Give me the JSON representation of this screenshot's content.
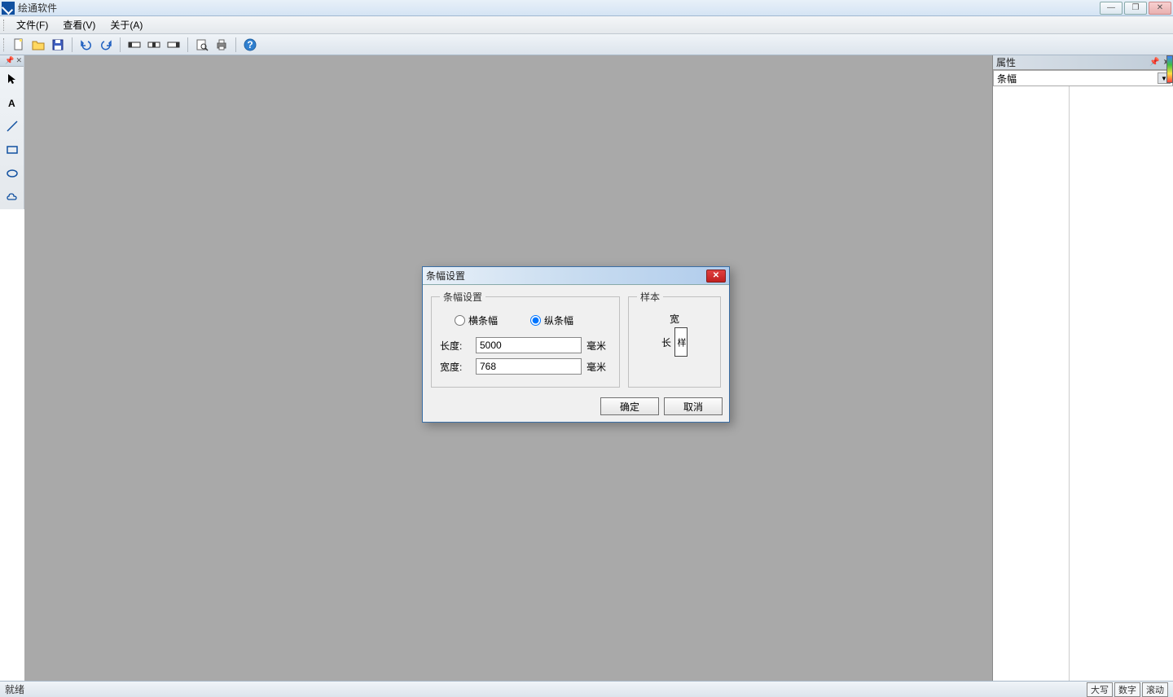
{
  "app": {
    "title": "绘通软件"
  },
  "menu": {
    "file": "文件(F)",
    "view": "查看(V)",
    "about": "关于(A)"
  },
  "toolbar_icons": {
    "new": "new-file-icon",
    "open": "open-folder-icon",
    "save": "save-icon",
    "undo": "undo-icon",
    "redo": "redo-icon",
    "group1": "layout-h-icon",
    "group2": "layout-v-icon",
    "group3": "layout-c-icon",
    "search": "search-icon",
    "print": "print-icon",
    "help": "help-icon"
  },
  "tools": {
    "pointer": "pointer",
    "text": "text",
    "line": "line",
    "rect": "rect",
    "ellipse": "ellipse",
    "cloud": "cloud"
  },
  "props": {
    "title": "属性",
    "selected": "条幅"
  },
  "status": {
    "text": "就绪",
    "caps": "大写",
    "num": "数字",
    "scroll": "滚动"
  },
  "dialog": {
    "title": "条幅设置",
    "legend_settings": "条幅设置",
    "legend_sample": "样本",
    "radio_h": "横条幅",
    "radio_v": "纵条幅",
    "selected_orientation": "v",
    "length_label": "长度:",
    "length_value": "5000",
    "width_label": "宽度:",
    "width_value": "768",
    "unit": "毫米",
    "sample_width": "宽",
    "sample_length": "长",
    "sample_text": "样",
    "ok": "确定",
    "cancel": "取消"
  }
}
